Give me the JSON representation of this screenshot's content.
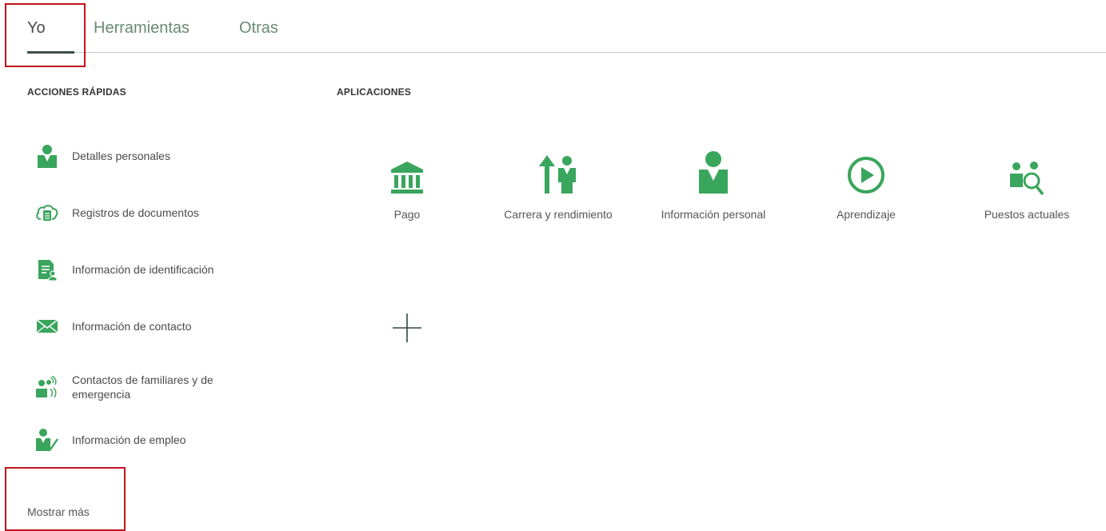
{
  "tabs": [
    {
      "label": "Yo",
      "active": true
    },
    {
      "label": "Herramientas",
      "active": false
    },
    {
      "label": "Otras",
      "active": false
    }
  ],
  "quick_actions": {
    "title": "ACCIONES RÁPIDAS",
    "items": [
      {
        "label": "Detalles personales",
        "icon": "person-icon"
      },
      {
        "label": "Registros de documentos",
        "icon": "cloud-document-icon"
      },
      {
        "label": "Información de identificación",
        "icon": "id-document-icon"
      },
      {
        "label": "Información de contacto",
        "icon": "envelope-icon"
      },
      {
        "label": "Contactos de familiares y de emergencia",
        "icon": "family-contacts-icon"
      },
      {
        "label": "Información de empleo",
        "icon": "person-pencil-icon"
      }
    ],
    "show_more": "Mostrar más"
  },
  "applications": {
    "title": "APLICACIONES",
    "items": [
      {
        "label": "Pago",
        "icon": "bank-icon"
      },
      {
        "label": "Carrera y rendimiento",
        "icon": "career-arrow-icon"
      },
      {
        "label": "Información personal",
        "icon": "person-icon"
      },
      {
        "label": "Aprendizaje",
        "icon": "play-circle-icon"
      },
      {
        "label": "Puestos actuales",
        "icon": "people-search-icon"
      }
    ],
    "add_icon": "plus-icon"
  },
  "colors": {
    "accent": "#3aa55c",
    "highlight": "#c0141c",
    "tab_underline": "#3c4f45"
  }
}
